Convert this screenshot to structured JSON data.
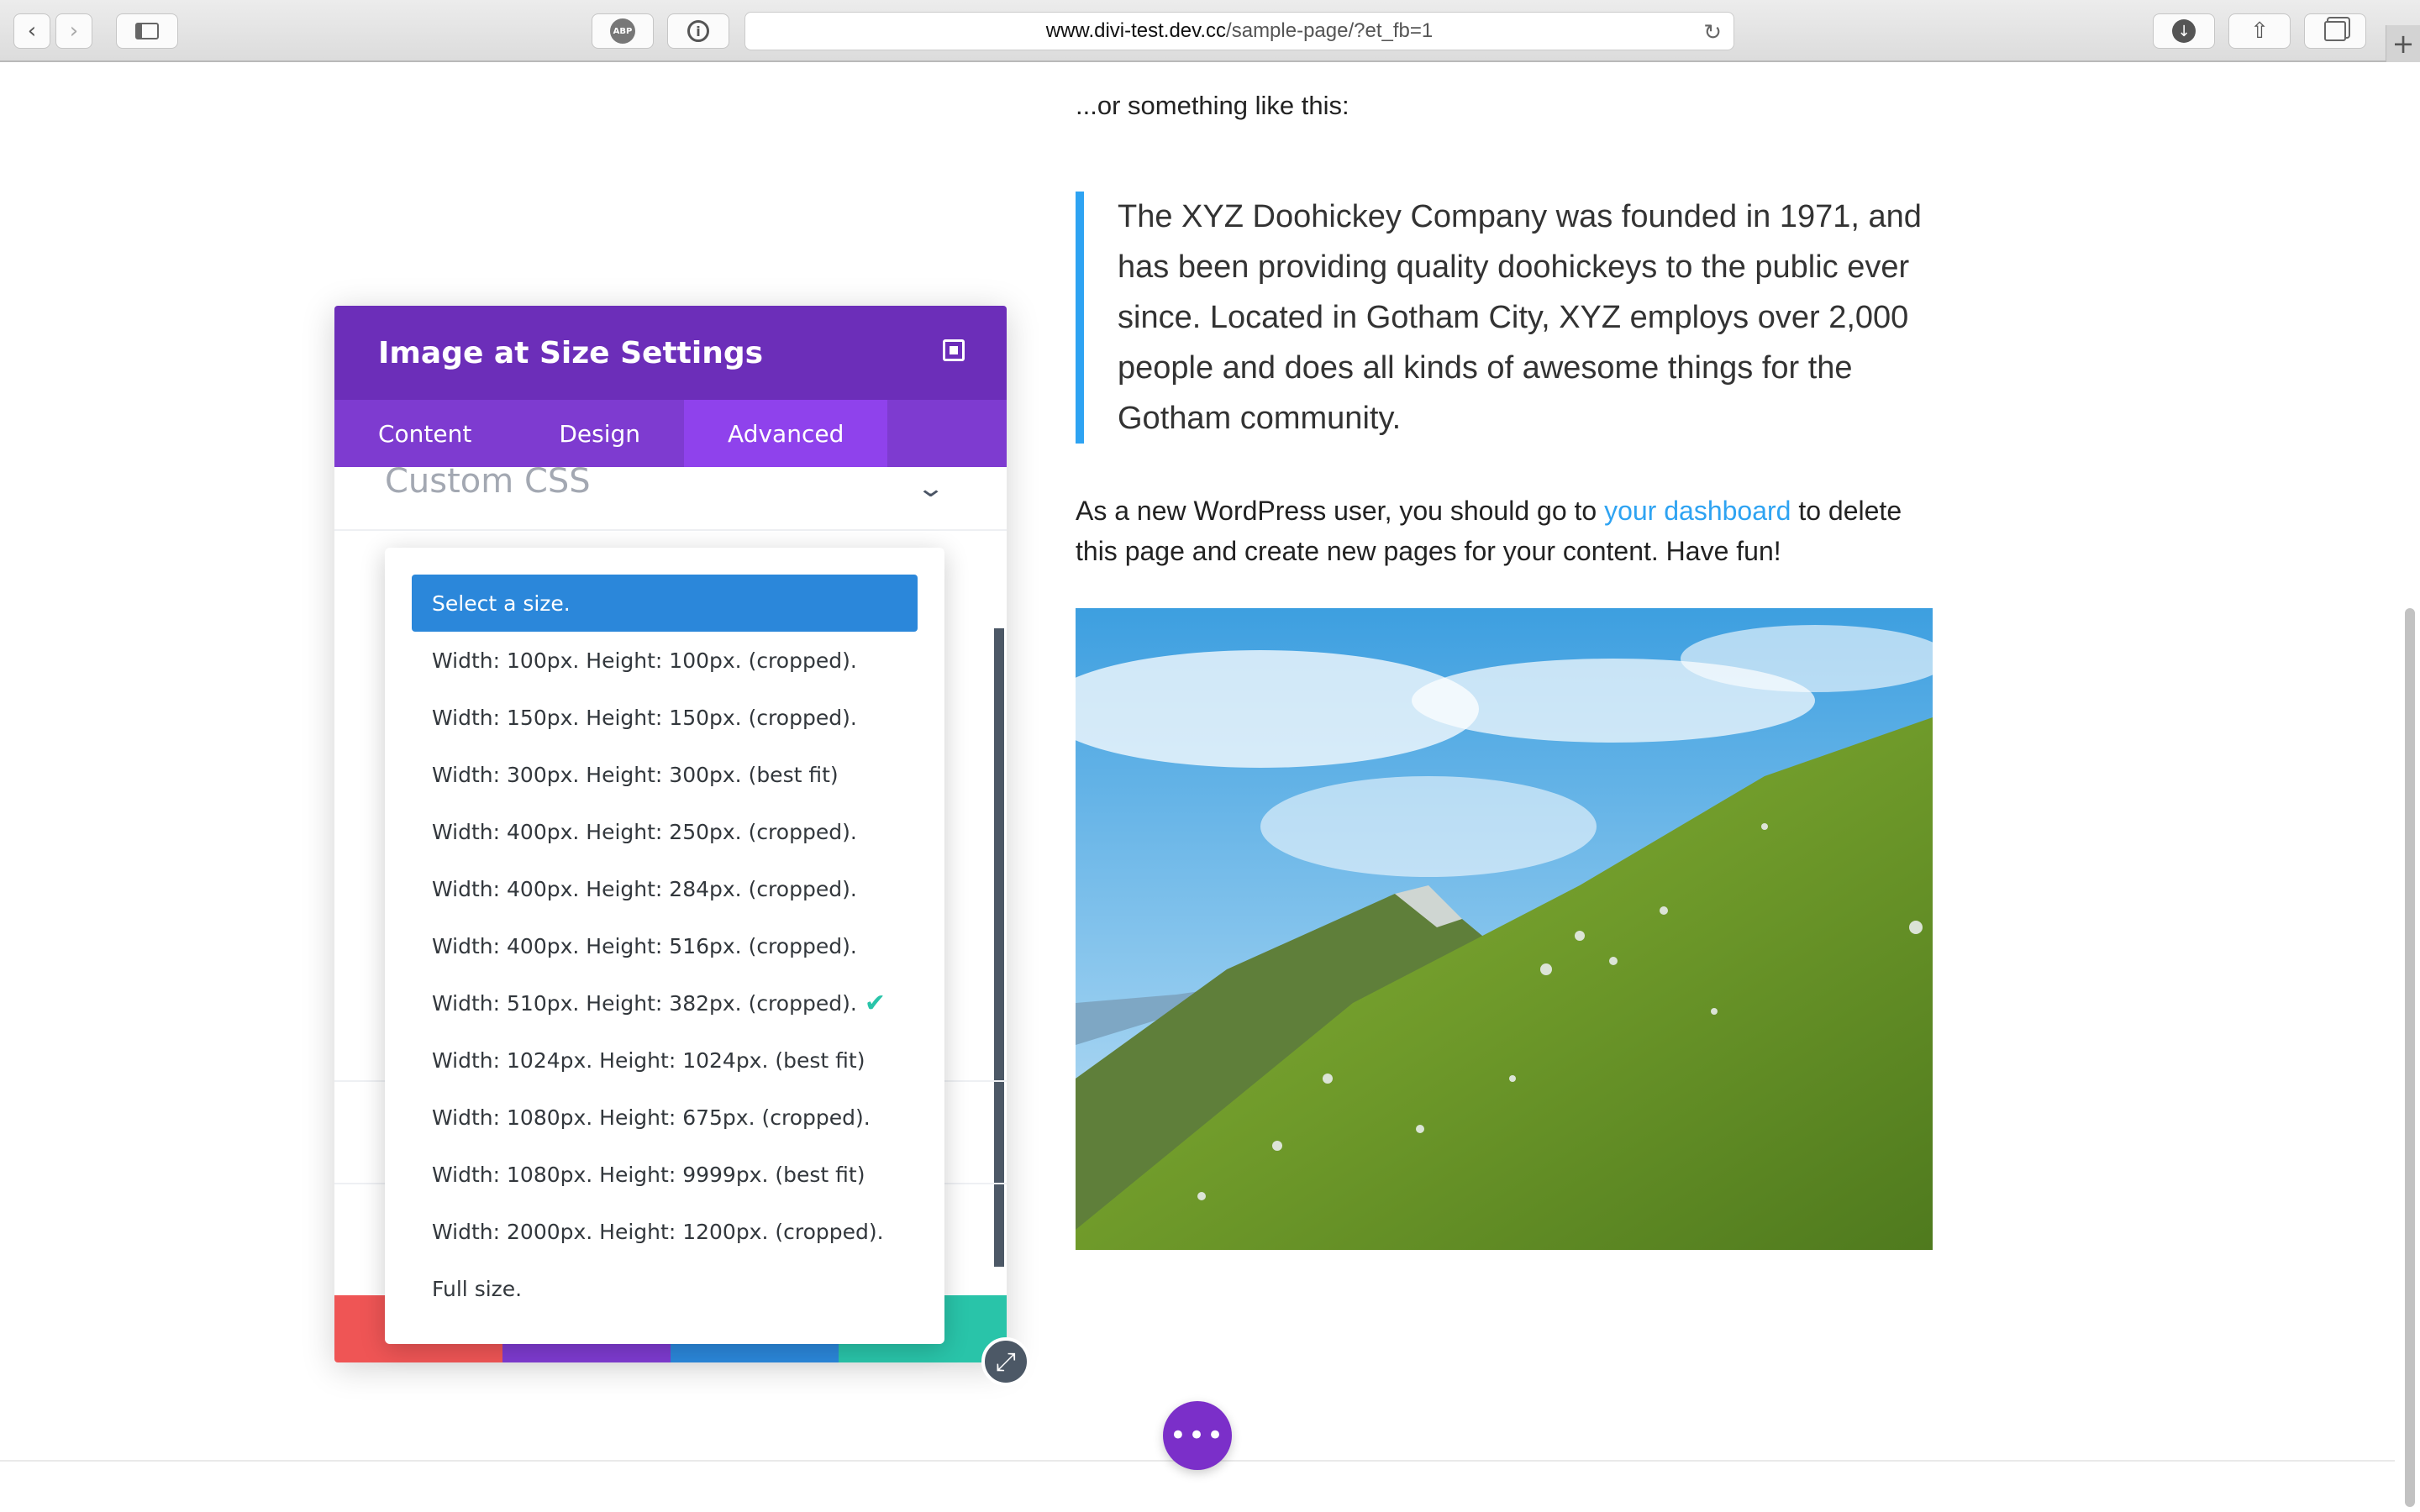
{
  "browser": {
    "url_domain": "www.divi-test.dev.cc",
    "url_path": "/sample-page/?et_fb=1",
    "adblock_label": "ABP"
  },
  "page": {
    "intro": "...or something like this:",
    "quote": "The XYZ Doohickey Company was founded in 1971, and has been providing quality doohickeys to the public ever since. Located in Gotham City, XYZ employs over 2,000 people and does all kinds of awesome things for the Gotham community.",
    "para_before": "As a new WordPress user, you should go to ",
    "para_link": "your dashboard",
    "para_after": " to delete this page and create new pages for your content. Have fun!",
    "fab_label": "•••"
  },
  "modal": {
    "title": "Image at Size Settings",
    "tabs": [
      "Content",
      "Design",
      "Advanced"
    ],
    "active_tab": "Advanced",
    "section_title": "Custom CSS",
    "footer_colors": [
      "#ef5555",
      "#7e3bd0",
      "#2b87da",
      "#29c4a9"
    ]
  },
  "dropdown": {
    "options": [
      "Select a size.",
      "Width: 100px. Height: 100px. (cropped).",
      "Width: 150px. Height: 150px. (cropped).",
      "Width: 300px. Height: 300px. (best fit)",
      "Width: 400px. Height: 250px. (cropped).",
      "Width: 400px. Height: 284px. (cropped).",
      "Width: 400px. Height: 516px. (cropped).",
      "Width: 510px. Height: 382px. (cropped).",
      "Width: 1024px. Height: 1024px. (best fit)",
      "Width: 1080px. Height: 675px. (cropped).",
      "Width: 1080px. Height: 9999px. (best fit)",
      "Width: 2000px. Height: 1200px. (cropped).",
      "Full size."
    ],
    "highlighted": "Select a size.",
    "checked": "Width: 510px. Height: 382px. (cropped)."
  },
  "colors": {
    "header": "#6c2eb9",
    "tabs": "#7e3bd0",
    "link": "#2ea3f2",
    "check": "#29c4a9"
  }
}
